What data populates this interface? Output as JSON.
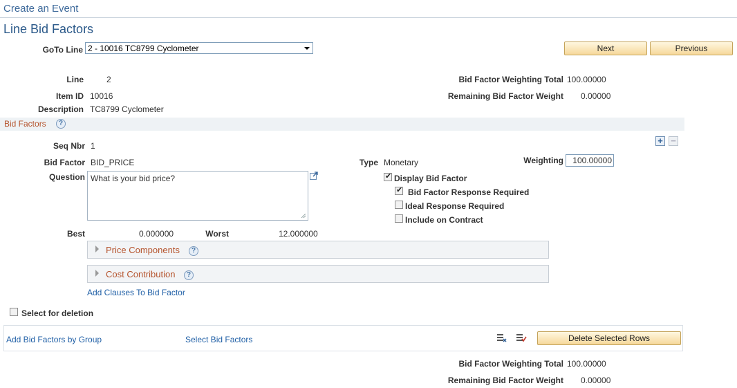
{
  "breadcrumb": "Create an Event",
  "page_title": "Line Bid Factors",
  "goto": {
    "label": "GoTo Line",
    "value": "2 - 10016 TC8799 Cyclometer"
  },
  "nav": {
    "next": "Next",
    "previous": "Previous"
  },
  "line_info": {
    "line_label": "Line",
    "line_value": "2",
    "item_label": "Item ID",
    "item_value": "10016",
    "desc_label": "Description",
    "desc_value": "TC8799 Cyclometer",
    "total_label": "Bid Factor Weighting Total",
    "total_value": "100.00000",
    "remaining_label": "Remaining Bid Factor Weight",
    "remaining_value": "0.00000"
  },
  "section": {
    "title": "Bid Factors",
    "help": "?"
  },
  "bid_factor": {
    "seq_label": "Seq Nbr",
    "seq_value": "1",
    "factor_label": "Bid Factor",
    "factor_value": "BID_PRICE",
    "type_label": "Type",
    "type_value": "Monetary",
    "weighting_label": "Weighting",
    "weighting_value": "100.00000",
    "question_label": "Question",
    "question_value": "What is your bid price?",
    "display_label": "Display Bid Factor",
    "response_required_label": "Bid Factor Response Required",
    "ideal_label": "Ideal Response Required",
    "contract_label": "Include on Contract",
    "best_label": "Best",
    "best_value": "0.000000",
    "worst_label": "Worst",
    "worst_value": "12.000000",
    "price_components": "Price Components",
    "cost_contribution": "Cost Contribution",
    "add_clauses": "Add Clauses To Bid Factor"
  },
  "checkboxes": {
    "display": true,
    "response_required": true,
    "ideal": false,
    "contract": false,
    "select_delete": false
  },
  "select_delete_label": "Select for deletion",
  "footer": {
    "add_group": "Add Bid Factors by Group",
    "select_factors": "Select Bid Factors",
    "delete_rows": "Delete Selected Rows",
    "total_label": "Bid Factor Weighting Total",
    "total_value": "100.00000",
    "remaining_label": "Remaining Bid Factor Weight",
    "remaining_value": "0.00000"
  },
  "icons": {
    "add_row": "plus-icon",
    "delete_row": "minus-icon",
    "expand": "expand-textarea-icon",
    "select_all": "select-all-icon",
    "deselect_all": "deselect-all-icon",
    "collapse_arrow": "triangle-right-icon"
  },
  "colors": {
    "link": "#1f5fa6",
    "section_title": "#b5532c",
    "button": "#f6d89a"
  }
}
